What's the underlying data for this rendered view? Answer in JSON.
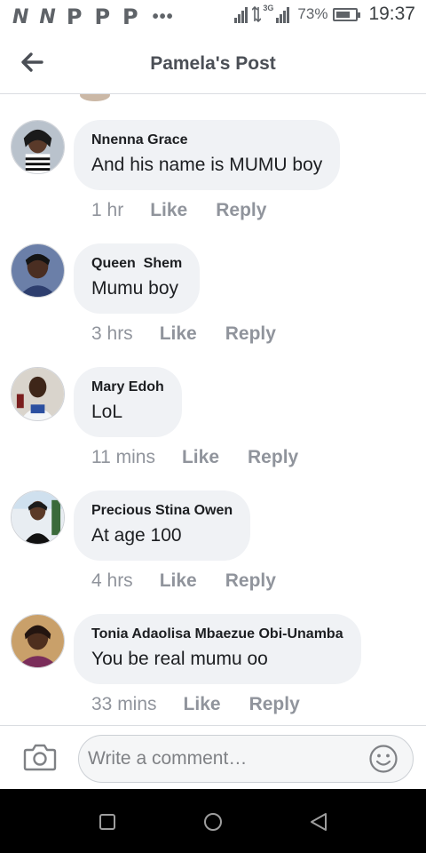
{
  "status_bar": {
    "notification_icons": [
      "N",
      "N",
      "P",
      "P",
      "P"
    ],
    "more_indicator": "•••",
    "network_type": "3G",
    "battery_percent": "73%",
    "battery_level": 0.73,
    "time": "19:37"
  },
  "header": {
    "title": "Pamela's Post"
  },
  "actions": {
    "like_label": "Like",
    "reply_label": "Reply"
  },
  "comments": [
    {
      "author": "Nnenna Grace",
      "text": "And his name is MUMU boy",
      "time": "1 hr"
    },
    {
      "author": "Queen  Shem",
      "text": "Mumu boy",
      "time": "3 hrs"
    },
    {
      "author": "Mary Edoh",
      "text": "LoL",
      "time": "11 mins"
    },
    {
      "author": "Precious Stina Owen",
      "text": "At age 100",
      "time": "4 hrs"
    },
    {
      "author": "Tonia Adaolisa Mbaezue Obi-Unamba",
      "text": "You be real mumu oo",
      "time": "33 mins"
    }
  ],
  "composer": {
    "placeholder": "Write a comment…",
    "value": ""
  },
  "icons": {
    "back": "arrow-left-icon",
    "camera": "camera-icon",
    "emoji": "smiley-icon",
    "nav_recent": "square-icon",
    "nav_home": "circle-icon",
    "nav_back": "triangle-back-icon"
  },
  "colors": {
    "bubble": "#f0f2f5",
    "meta_text": "#90949c",
    "title_text": "#4b4f56",
    "navbar": "#000000"
  }
}
